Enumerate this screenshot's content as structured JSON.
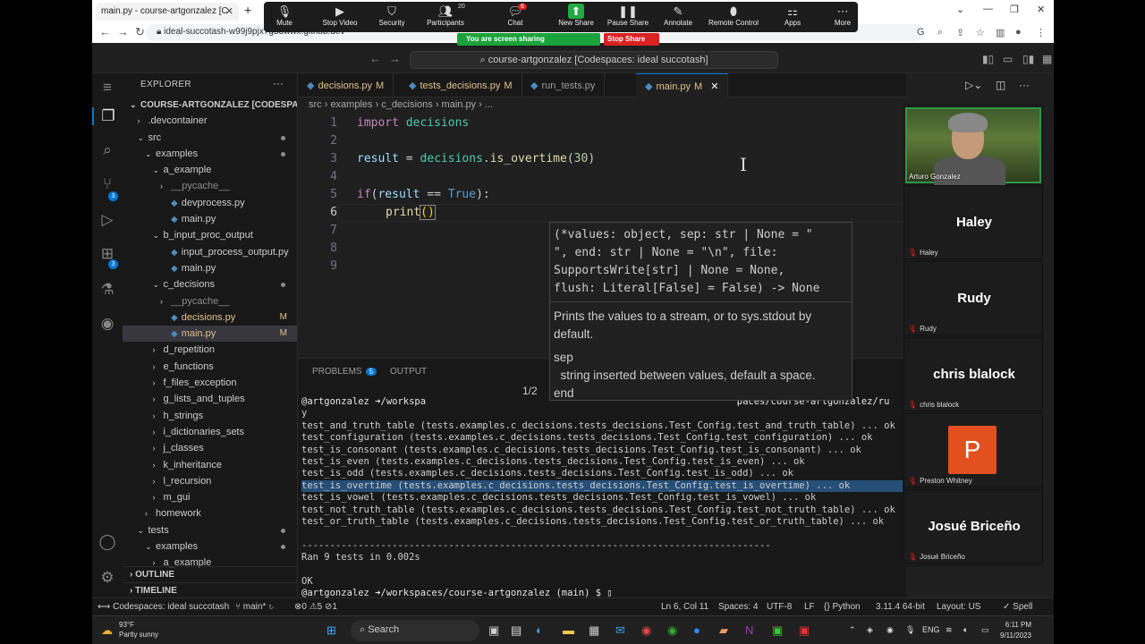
{
  "browser": {
    "tab_title": "main.py - course-artgonzalez [C",
    "url": "ideal-succotash-w99j9pjx7g53wwx.github.dev",
    "zoom_buttons": [
      {
        "label": "Mute",
        "icon": "microphone-icon"
      },
      {
        "label": "Stop Video",
        "icon": "video-icon"
      },
      {
        "label": "Security",
        "icon": "shield-icon"
      },
      {
        "label": "Participants",
        "icon": "participants-icon",
        "count": "20"
      },
      {
        "label": "Chat",
        "icon": "chat-icon",
        "count": "6"
      },
      {
        "label": "New Share",
        "icon": "share-icon"
      },
      {
        "label": "Pause Share",
        "icon": "pause-icon"
      },
      {
        "label": "Annotate",
        "icon": "pencil-icon"
      },
      {
        "label": "Remote Control",
        "icon": "mouse-icon"
      },
      {
        "label": "Apps",
        "icon": "apps-icon"
      },
      {
        "label": "More",
        "icon": "more-icon"
      }
    ],
    "sharing_text": "You are screen sharing",
    "stop_share": "Stop Share"
  },
  "vscode": {
    "command_center": "course-artgonzalez [Codespaces: ideal succotash]",
    "explorer_title": "EXPLORER",
    "tree": [
      {
        "label": "COURSE-ARTGONZALEZ [CODESPACE...",
        "indent": 0,
        "twisty": "⌄",
        "bold": true
      },
      {
        "label": ".devcontainer",
        "indent": 1,
        "twisty": "›"
      },
      {
        "label": "src",
        "indent": 1,
        "twisty": "⌄",
        "dot": true
      },
      {
        "label": "examples",
        "indent": 2,
        "twisty": "⌄",
        "dot": true
      },
      {
        "label": "a_example",
        "indent": 3,
        "twisty": "⌄"
      },
      {
        "label": "__pycache__",
        "indent": 4,
        "twisty": "›",
        "dim": true
      },
      {
        "label": "devprocess.py",
        "indent": 4,
        "py": true
      },
      {
        "label": "main.py",
        "indent": 4,
        "py": true
      },
      {
        "label": "b_input_proc_output",
        "indent": 3,
        "twisty": "⌄"
      },
      {
        "label": "input_process_output.py",
        "indent": 4,
        "py": true
      },
      {
        "label": "main.py",
        "indent": 4,
        "py": true
      },
      {
        "label": "c_decisions",
        "indent": 3,
        "twisty": "⌄",
        "dot": true
      },
      {
        "label": "__pycache__",
        "indent": 4,
        "twisty": "›",
        "dim": true
      },
      {
        "label": "decisions.py",
        "indent": 4,
        "py": true,
        "mark": "M"
      },
      {
        "label": "main.py",
        "indent": 4,
        "py": true,
        "mark": "M",
        "selected": true
      },
      {
        "label": "d_repetition",
        "indent": 3,
        "twisty": "›"
      },
      {
        "label": "e_functions",
        "indent": 3,
        "twisty": "›"
      },
      {
        "label": "f_files_exception",
        "indent": 3,
        "twisty": "›"
      },
      {
        "label": "g_lists_and_tuples",
        "indent": 3,
        "twisty": "›"
      },
      {
        "label": "h_strings",
        "indent": 3,
        "twisty": "›"
      },
      {
        "label": "i_dictionaries_sets",
        "indent": 3,
        "twisty": "›"
      },
      {
        "label": "j_classes",
        "indent": 3,
        "twisty": "›"
      },
      {
        "label": "k_inheritance",
        "indent": 3,
        "twisty": "›"
      },
      {
        "label": "l_recursion",
        "indent": 3,
        "twisty": "›"
      },
      {
        "label": "m_gui",
        "indent": 3,
        "twisty": "›"
      },
      {
        "label": "homework",
        "indent": 2,
        "twisty": "›"
      },
      {
        "label": "tests",
        "indent": 1,
        "twisty": "⌄",
        "dot": true
      },
      {
        "label": "examples",
        "indent": 2,
        "twisty": "⌄",
        "dot": true
      },
      {
        "label": "a_example",
        "indent": 3,
        "twisty": "›"
      }
    ],
    "outline": "OUTLINE",
    "timeline": "TIMELINE",
    "tabs": [
      {
        "label": "decisions.py",
        "mark": "M"
      },
      {
        "label": "tests_decisions.py",
        "mark": "M"
      },
      {
        "label": "run_tests.py",
        "mark": ""
      },
      {
        "label": "main.py",
        "mark": "M",
        "active": true
      }
    ],
    "breadcrumb": "src  ›  examples  ›  c_decisions  ›  main.py  ›  ...",
    "line_numbers": [
      "1",
      "2",
      "3",
      "4",
      "5",
      "6",
      "7",
      "8",
      "9"
    ],
    "hover": {
      "signature": [
        "(*values: object, sep: str | None = \"",
        "\", end: str | None = \"\\n\", file:",
        "SupportsWrite[str] | None = None,",
        "flush: Literal[False] = False) -> None"
      ],
      "doc1": "Prints the values to a stream, or to sys.stdout by default.",
      "doc_sep": "sep",
      "doc_sep_desc": "  string inserted between values, default a space.",
      "doc_end": "end",
      "counter": "1/2"
    },
    "panel_tabs": {
      "problems": "PROBLEMS",
      "problems_count": "5",
      "output": "OUTPUT"
    },
    "terminal": [
      "@artgonzalez ➜/workspa                                                       paces/course-artgonzalez/ru",
      "y",
      "test_and_truth_table (tests.examples.c_decisions.tests_decisions.Test_Config.test_and_truth_table) ... ok",
      "test_configuration (tests.examples.c_decisions.tests_decisions.Test_Config.test_configuration) ... ok",
      "test_is_consonant (tests.examples.c_decisions.tests_decisions.Test_Config.test_is_consonant) ... ok",
      "test_is_even (tests.examples.c_decisions.tests_decisions.Test_Config.test_is_even) ... ok",
      "test_is_odd (tests.examples.c_decisions.tests_decisions.Test_Config.test_is_odd) ... ok",
      "test_is_overtime (tests.examples.c_decisions.tests_decisions.Test_Config.test_is_overtime) ... ok",
      "test_is_vowel (tests.examples.c_decisions.tests_decisions.Test_Config.test_is_vowel) ... ok",
      "test_not_truth_table (tests.examples.c_decisions.tests_decisions.Test_Config.test_not_truth_table) ... ok",
      "test_or_truth_table (tests.examples.c_decisions.tests_decisions.Test_Config.test_or_truth_table) ... ok",
      "",
      "-----------------------------------------------------------------------------------",
      "Ran 9 tests in 0.002s",
      "",
      "OK",
      "@artgonzalez ➜/workspaces/course-artgonzalez (main) $ ▯"
    ],
    "status": {
      "remote": "Codespaces: ideal succotash",
      "branch": "main*",
      "problems": "⊗0 ⚠5  ⊘1",
      "position": "Ln 6, Col 11",
      "spaces": "Spaces: 4",
      "encoding": "UTF-8",
      "eol": "LF",
      "language": "Python",
      "interpreter": "3.11.4 64-bit",
      "layout": "Layout: US",
      "spell": "✓ Spell"
    }
  },
  "participants": [
    {
      "name": "Arturo Gonzalez",
      "video": true
    },
    {
      "name": "Haley",
      "label": "Haley"
    },
    {
      "name": "Rudy",
      "label": "Rudy"
    },
    {
      "name": "chris blalock",
      "label": "chris blalock"
    },
    {
      "name": "P",
      "label": "Preston Whitney",
      "avatar": true
    },
    {
      "name": "Josué Briceño",
      "label": "Josué Briceño"
    }
  ],
  "taskbar": {
    "temp": "93°F",
    "weather": "Partly sunny",
    "search": "Search",
    "lang": "ENG",
    "time": "6:11 PM",
    "date": "9/11/2023"
  },
  "colors": {
    "accent": "#0078d4",
    "sharing": "#1aa33a",
    "stop": "#d92222",
    "avatar": "#e1501e"
  }
}
